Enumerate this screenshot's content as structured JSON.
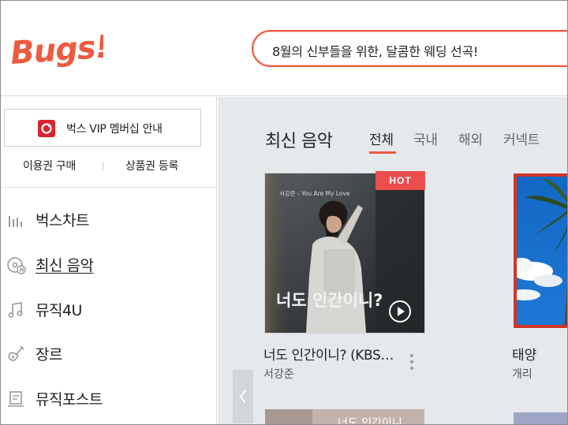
{
  "header": {
    "logo_text": "Bugs!",
    "search_text": "8월의 신부들을 위한, 달콤한 웨딩 선곡!"
  },
  "sidebar": {
    "vip_label": "벅스 VIP 멤버십 안내",
    "sub_links": [
      "이용권 구매",
      "상품권 등록"
    ],
    "nav": [
      {
        "label": "벅스차트",
        "icon": "chart-bars-icon"
      },
      {
        "label": "최신 음악",
        "icon": "new-disc-icon"
      },
      {
        "label": "뮤직4U",
        "icon": "music-note-icon"
      },
      {
        "label": "장르",
        "icon": "guitar-icon"
      },
      {
        "label": "뮤직포스트",
        "icon": "post-icon"
      }
    ]
  },
  "main": {
    "section_title": "최신 음악",
    "tabs": [
      "전체",
      "국내",
      "해외",
      "커넥트"
    ],
    "albums": [
      {
        "title": "너도 인간이니? (KBS…",
        "artist": "서강준",
        "badge": "HOT",
        "cover_caption": "서강준 - You Are My Love",
        "cover_title": "너도 인간이니?"
      },
      {
        "title": "태양",
        "artist": "개리"
      }
    ],
    "row2_cover_caption": "너도 인간이니"
  },
  "colors": {
    "accent": "#ec5b41",
    "hot_badge": "#ec4e4e",
    "vip_icon": "#d8262f",
    "main_bg": "#e6e9ec"
  }
}
